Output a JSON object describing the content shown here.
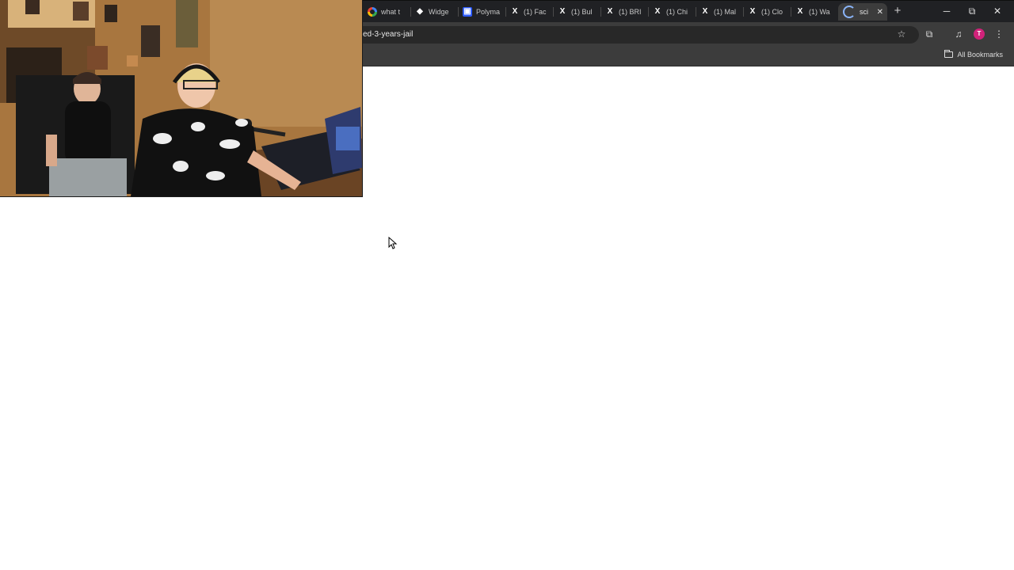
{
  "browser": {
    "tabs": [
      {
        "title": "what t",
        "icon": "google-icon"
      },
      {
        "title": "Widge",
        "icon": "widget-icon"
      },
      {
        "title": "Polyma",
        "icon": "polymarket-icon"
      },
      {
        "title": "(1) Fac",
        "icon": "x-icon"
      },
      {
        "title": "(1) Bul",
        "icon": "x-icon"
      },
      {
        "title": "(1) BRI",
        "icon": "x-icon"
      },
      {
        "title": "(1) Chi",
        "icon": "x-icon"
      },
      {
        "title": "(1) Mal",
        "icon": "x-icon"
      },
      {
        "title": "(1) Clo",
        "icon": "x-icon"
      },
      {
        "title": "(1) Wa",
        "icon": "x-icon"
      },
      {
        "title": "sci",
        "icon": "loading-icon",
        "active": true
      }
    ],
    "new_tab_symbol": "+",
    "window_controls": {
      "minimize": "─",
      "restore": "⧉",
      "close": "✕"
    },
    "address_bar": {
      "url_visible": "ed-3-years-jail"
    },
    "toolbar_icons": {
      "bookmark_star": "☆",
      "extensions": "⧉",
      "media": "♫",
      "menu": "⋮"
    },
    "profile_initial": "T",
    "bookmarks_bar": {
      "all_bookmarks_label": "All Bookmarks"
    }
  },
  "colors": {
    "chrome_dark": "#202124",
    "toolbar": "#3c3c3c",
    "page_background": "#ffffff",
    "profile_avatar": "#d0227a"
  }
}
